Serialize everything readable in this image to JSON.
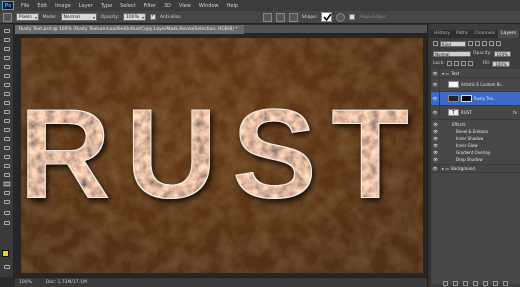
{
  "app": {
    "logo": "Ps"
  },
  "menu": [
    "File",
    "Edit",
    "Image",
    "Layer",
    "Type",
    "Select",
    "Filter",
    "3D",
    "View",
    "Window",
    "Help"
  ],
  "options_bar": {
    "preset": "Pixels",
    "mode_label": "Mode:",
    "mode_value": "Normal",
    "opacity_label": "Opacity:",
    "opacity_value": "100%",
    "antialias_label": "Anti-alias",
    "shape_label": "Shape:",
    "align_edges_label": "Align Edges"
  },
  "document": {
    "tab_title": "Rusty Text.psd @ 100% (Rusty Texture-LoadSelOnRustCopy,LayerMask,RevealSelection, RGB/8) *",
    "canvas_text": "RUST"
  },
  "status": {
    "zoom": "100%",
    "doc_size": "Doc: 1.72M/17.1M"
  },
  "panels": {
    "tabs": [
      "History",
      "Paths",
      "Channels",
      "Layers"
    ],
    "active_tab": "Layers",
    "kind_label": "Kind",
    "blend_mode": "Normal",
    "opacity_label": "Opacity:",
    "opacity_value": "100%",
    "lock_label": "Lock:",
    "fill_label": "Fill:",
    "fill_value": "100%"
  },
  "layers": [
    {
      "name": "Text",
      "type": "group"
    },
    {
      "name": "Artistic 6 Custom Br...",
      "type": "layer"
    },
    {
      "name": "Rusty Tex...",
      "type": "layer",
      "selected": true
    },
    {
      "name": "RUST",
      "type": "text"
    },
    {
      "name": "Effects",
      "type": "effects-header"
    },
    {
      "name": "Bevel & Emboss",
      "type": "effect"
    },
    {
      "name": "Inner Shadow",
      "type": "effect"
    },
    {
      "name": "Inner Glow",
      "type": "effect"
    },
    {
      "name": "Gradient Overlay",
      "type": "effect"
    },
    {
      "name": "Drop Shadow",
      "type": "effect"
    },
    {
      "name": "Background",
      "type": "group"
    }
  ],
  "colors": {
    "foreground": "#f2d600",
    "background": "#ffffff",
    "selection": "#3c68c8",
    "accent_blue": "#31a8ff"
  }
}
